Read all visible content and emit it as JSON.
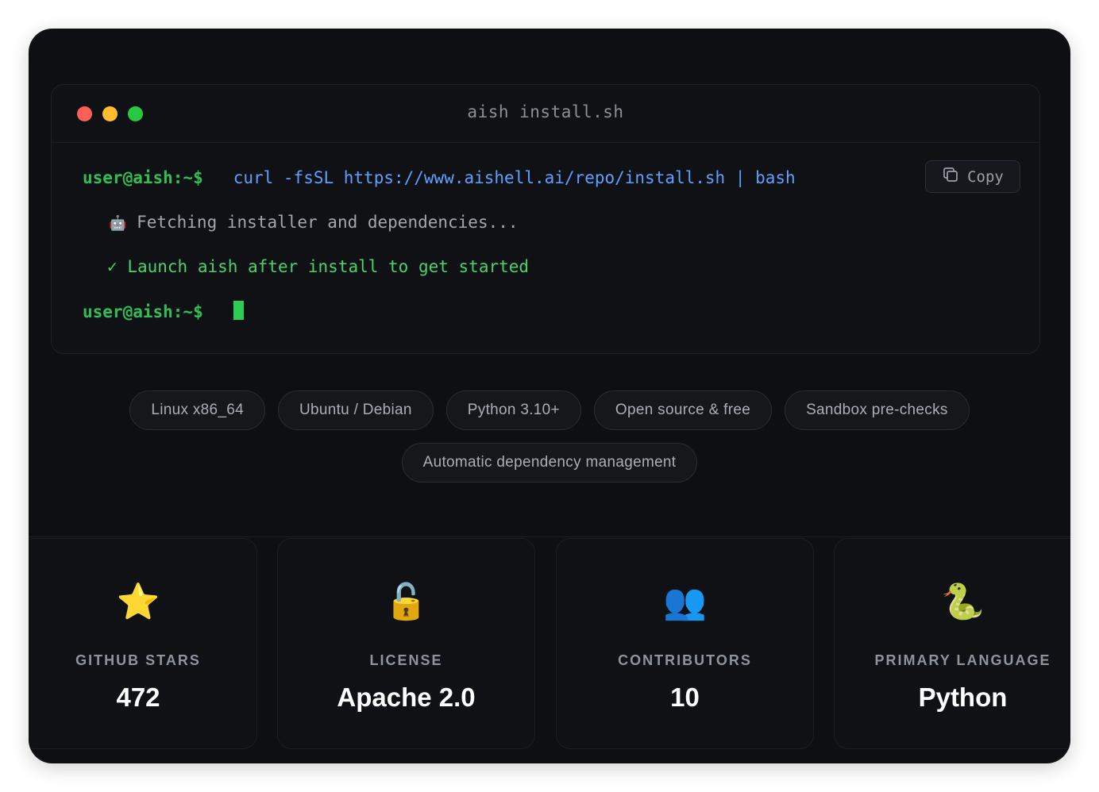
{
  "terminal": {
    "title": "aish install.sh",
    "copy_label": "Copy",
    "prompt": "user@aish:~$",
    "command": "curl -fsSL https://www.aishell.ai/repo/install.sh | bash",
    "output_fetch": "Fetching installer and dependencies...",
    "output_fetch_icon": "🤖",
    "output_ok_mark": "✓",
    "output_ok": "Launch aish after install to get started"
  },
  "chips": {
    "row1": [
      "Linux x86_64",
      "Ubuntu / Debian",
      "Python 3.10+",
      "Open source & free",
      "Sandbox pre-checks"
    ],
    "row2": [
      "Automatic dependency management"
    ]
  },
  "stats": [
    {
      "icon": "⭐",
      "icon_name": "star-icon",
      "label": "GITHUB STARS",
      "value": "472"
    },
    {
      "icon": "🔓",
      "icon_name": "unlock-icon",
      "label": "LICENSE",
      "value": "Apache 2.0"
    },
    {
      "icon": "👥",
      "icon_name": "people-icon",
      "label": "CONTRIBUTORS",
      "value": "10"
    },
    {
      "icon": "🐍",
      "icon_name": "snake-icon",
      "label": "PRIMARY LANGUAGE",
      "value": "Python"
    }
  ],
  "colors": {
    "prompt": "#2fbf57",
    "command": "#5ea0ff",
    "success": "#47d46e",
    "background": "#0e0f12"
  }
}
